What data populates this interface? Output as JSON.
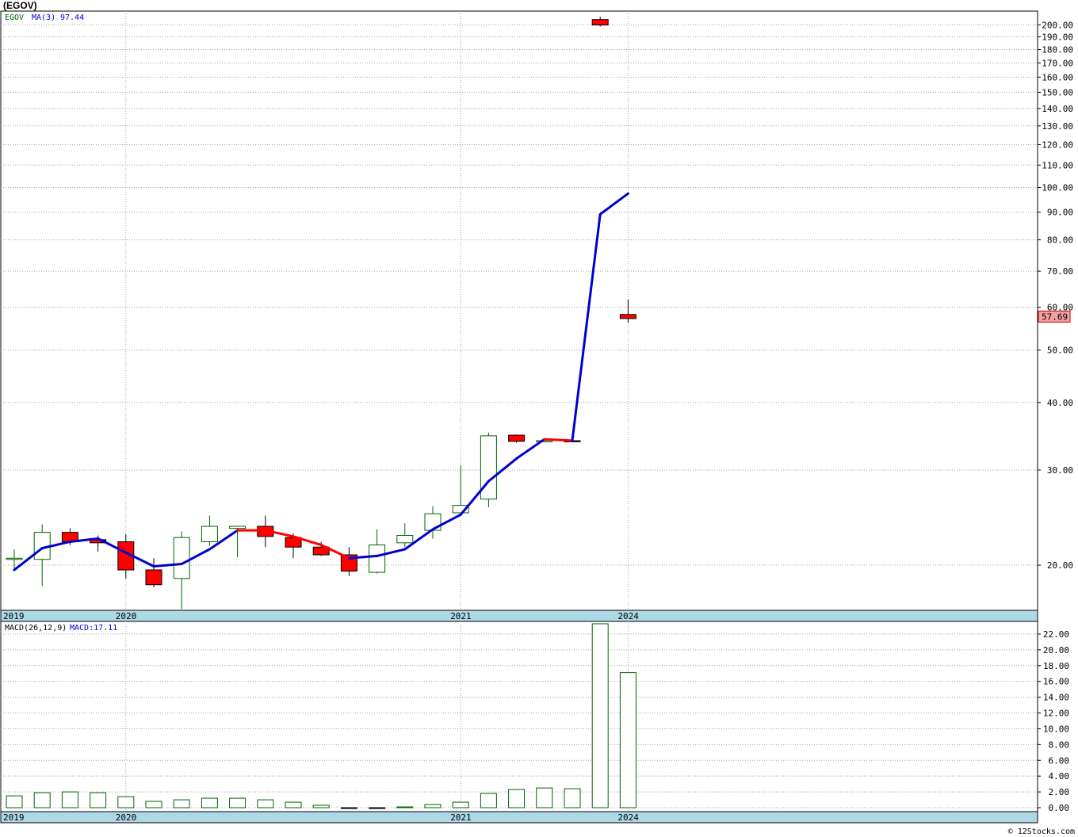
{
  "header": {
    "title": "(EGOV)",
    "copyright": "© 12Stocks.com"
  },
  "price_legend": {
    "symbol": "EGOV",
    "ma_label": "MA(3)",
    "ma_value": "97.44"
  },
  "macd_legend": {
    "label": "MACD(26,12,9)",
    "value_label": "MACD:17.11"
  },
  "last_price_label": "57.69",
  "colors": {
    "up_body": "#ffffff",
    "up_border": "#006400",
    "down_body": "#ff0000",
    "ma_line": "#0000cc",
    "ma_short_segment": "#ff0000",
    "axis_band": "#add8e6",
    "grid": "#a0a0a0",
    "last_price_box": "#f4a0a0"
  },
  "chart_data": [
    {
      "type": "candlestick",
      "panel": "price",
      "title": "(EGOV)",
      "y_scale": "log",
      "ylim": [
        16.5,
        212
      ],
      "y_ticks": [
        "20.00",
        "30.00",
        "40.00",
        "50.00",
        "60.00",
        "70.00",
        "80.00",
        "90.00",
        "100.00",
        "110.00",
        "120.00",
        "130.00",
        "140.00",
        "150.00",
        "160.00",
        "170.00",
        "180.00",
        "190.00",
        "200.00"
      ],
      "x_labels": [
        {
          "label": "2019",
          "index": 0
        },
        {
          "label": "2020",
          "index": 4
        },
        {
          "label": "2021",
          "index": 16
        },
        {
          "label": "2024",
          "index": 22
        }
      ],
      "candles": [
        {
          "o": 20.6,
          "h": 21.4,
          "l": 19.6,
          "c": 20.6
        },
        {
          "o": 20.5,
          "h": 23.8,
          "l": 18.3,
          "c": 23.0
        },
        {
          "o": 23.0,
          "h": 23.4,
          "l": 21.8,
          "c": 22.1
        },
        {
          "o": 22.3,
          "h": 22.7,
          "l": 21.2,
          "c": 22.0
        },
        {
          "o": 22.1,
          "h": 22.8,
          "l": 18.9,
          "c": 19.6
        },
        {
          "o": 19.6,
          "h": 20.6,
          "l": 18.2,
          "c": 18.4
        },
        {
          "o": 18.9,
          "h": 23.1,
          "l": 16.6,
          "c": 22.5
        },
        {
          "o": 22.1,
          "h": 24.7,
          "l": 21.7,
          "c": 23.6
        },
        {
          "o": 23.4,
          "h": 23.6,
          "l": 20.7,
          "c": 23.6
        },
        {
          "o": 23.6,
          "h": 24.7,
          "l": 21.6,
          "c": 22.6
        },
        {
          "o": 22.5,
          "h": 22.9,
          "l": 20.6,
          "c": 21.6
        },
        {
          "o": 21.6,
          "h": 22.1,
          "l": 20.8,
          "c": 20.9
        },
        {
          "o": 20.9,
          "h": 21.6,
          "l": 19.1,
          "c": 19.5
        },
        {
          "o": 19.4,
          "h": 23.3,
          "l": 19.3,
          "c": 21.8
        },
        {
          "o": 22.0,
          "h": 23.9,
          "l": 21.6,
          "c": 22.7
        },
        {
          "o": 23.2,
          "h": 25.7,
          "l": 22.4,
          "c": 24.9
        },
        {
          "o": 25.0,
          "h": 30.6,
          "l": 24.7,
          "c": 25.8
        },
        {
          "o": 26.5,
          "h": 35.2,
          "l": 25.6,
          "c": 34.7
        },
        {
          "o": 34.8,
          "h": 34.9,
          "l": 33.7,
          "c": 33.9
        },
        {
          "o": 34.0,
          "h": 34.4,
          "l": 33.8,
          "c": 34.0
        },
        {
          "o": 34.0,
          "h": 34.2,
          "l": 33.8,
          "c": 33.9
        },
        {
          "o": 204.5,
          "h": 207.0,
          "l": 198.6,
          "c": 199.8
        },
        {
          "o": 58.2,
          "h": 62.0,
          "l": 56.2,
          "c": 57.2
        }
      ],
      "ma_series": {
        "name": "MA(3)",
        "points": [
          {
            "i": 0,
            "v": 19.6
          },
          {
            "i": 1,
            "v": 21.5
          },
          {
            "i": 2,
            "v": 22.1
          },
          {
            "i": 3,
            "v": 22.4
          },
          {
            "i": 4,
            "v": 21.1
          },
          {
            "i": 5,
            "v": 19.9
          },
          {
            "i": 6,
            "v": 20.1
          },
          {
            "i": 7,
            "v": 21.4
          },
          {
            "i": 8,
            "v": 23.2
          },
          {
            "i": 9,
            "v": 23.2
          },
          {
            "i": 10,
            "v": 22.6
          },
          {
            "i": 11,
            "v": 21.8
          },
          {
            "i": 12,
            "v": 20.6
          },
          {
            "i": 13,
            "v": 20.8
          },
          {
            "i": 14,
            "v": 21.4
          },
          {
            "i": 15,
            "v": 23.3
          },
          {
            "i": 16,
            "v": 24.8
          },
          {
            "i": 17,
            "v": 28.6
          },
          {
            "i": 18,
            "v": 31.5
          },
          {
            "i": 19,
            "v": 34.2
          },
          {
            "i": 20,
            "v": 34.0
          },
          {
            "i": 21,
            "v": 89.2
          },
          {
            "i": 22,
            "v": 97.44
          }
        ],
        "red_segments": [
          [
            8,
            12
          ],
          [
            19,
            20
          ]
        ]
      },
      "last_price": 57.69
    },
    {
      "type": "bar",
      "panel": "macd",
      "title": "MACD(26,12,9)",
      "ylim": [
        -0.5,
        23.6
      ],
      "y_ticks": [
        "0.00",
        "2.00",
        "4.00",
        "6.00",
        "8.00",
        "10.00",
        "12.00",
        "14.00",
        "16.00",
        "18.00",
        "20.00",
        "22.00"
      ],
      "x_labels": [
        {
          "label": "2019",
          "index": 0
        },
        {
          "label": "2020",
          "index": 4
        },
        {
          "label": "2021",
          "index": 16
        },
        {
          "label": "2024",
          "index": 22
        }
      ],
      "values": [
        1.5,
        1.9,
        2.0,
        1.9,
        1.4,
        0.8,
        1.0,
        1.2,
        1.2,
        1.0,
        0.7,
        0.3,
        -0.1,
        -0.1,
        0.1,
        0.4,
        0.7,
        1.8,
        2.3,
        2.5,
        2.4,
        23.3,
        17.11
      ]
    }
  ]
}
